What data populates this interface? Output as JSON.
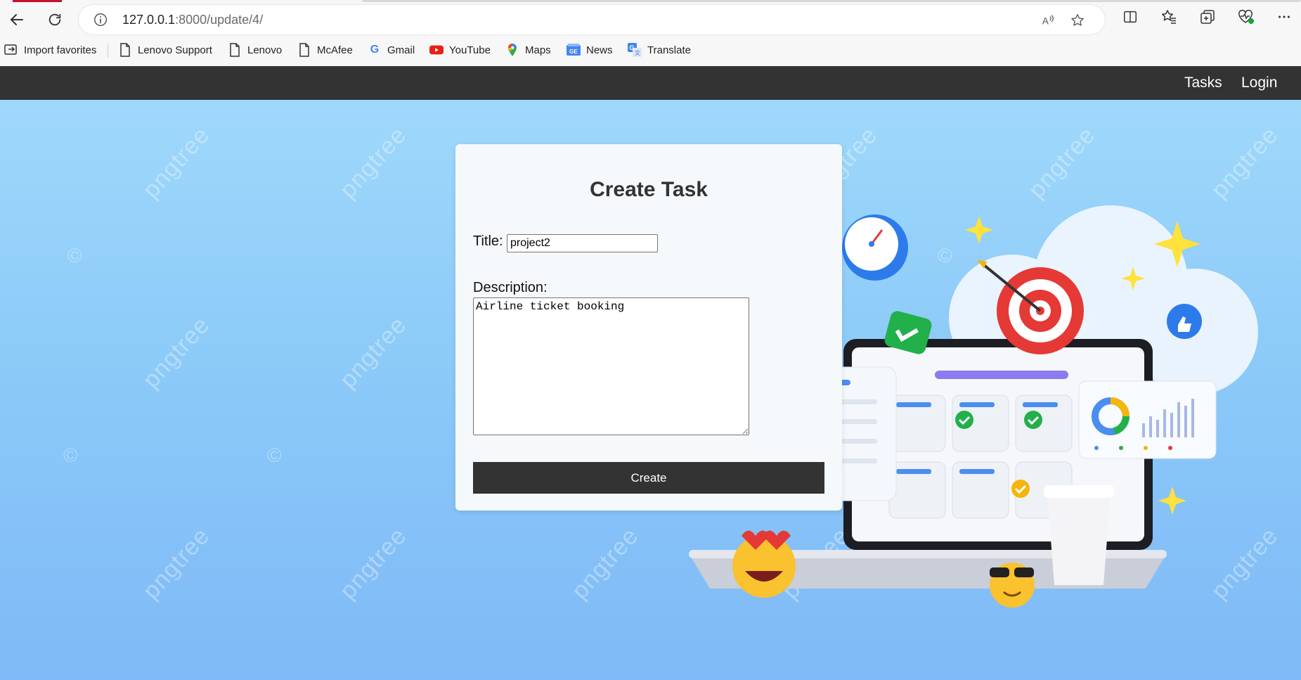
{
  "browser": {
    "url_host": "127.0.0.1",
    "url_path": ":8000/update/4/",
    "icons": [
      "back-icon",
      "refresh-icon",
      "info-icon",
      "read-aloud-icon",
      "star-icon",
      "split-screen-icon",
      "favorites-icon",
      "collections-icon",
      "performance-icon",
      "more-icon"
    ]
  },
  "favorites": [
    {
      "label": "Import favorites",
      "icon": "import-icon"
    },
    {
      "label": "Lenovo Support",
      "icon": "page-icon"
    },
    {
      "label": "Lenovo",
      "icon": "page-icon"
    },
    {
      "label": "McAfee",
      "icon": "page-icon"
    },
    {
      "label": "Gmail",
      "icon": "google-icon"
    },
    {
      "label": "YouTube",
      "icon": "youtube-icon"
    },
    {
      "label": "Maps",
      "icon": "maps-icon"
    },
    {
      "label": "News",
      "icon": "news-icon"
    },
    {
      "label": "Translate",
      "icon": "translate-icon"
    }
  ],
  "navbar": {
    "tasks_label": "Tasks",
    "login_label": "Login",
    "background": "#333333"
  },
  "form": {
    "heading": "Create Task",
    "title_label": "Title:",
    "title_value": "project2",
    "description_label": "Description:",
    "description_value": "Airline ticket booking",
    "submit_label": "Create"
  },
  "background": {
    "watermark_text": "pngtree",
    "colors": {
      "top": "#9fd8fb",
      "bottom": "#7fb9f7"
    }
  }
}
